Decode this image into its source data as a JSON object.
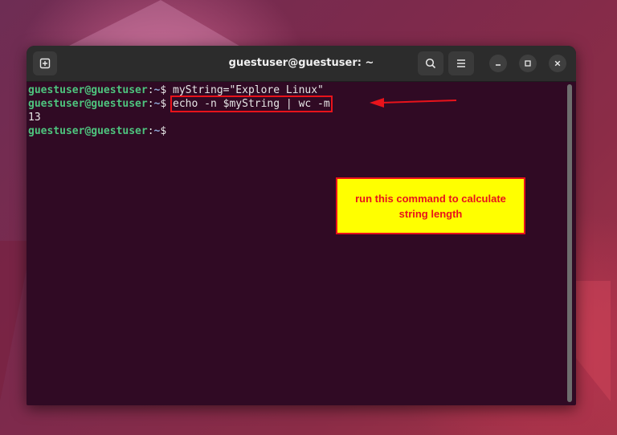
{
  "window": {
    "title": "guestuser@guestuser: ~"
  },
  "terminal": {
    "lines": [
      {
        "user": "guestuser@guestuser",
        "sep": ":",
        "path": "~",
        "sym": "$ ",
        "command": "myString=\"Explore Linux\""
      },
      {
        "user": "guestuser@guestuser",
        "sep": ":",
        "path": "~",
        "sym": "$ ",
        "command": "echo -n $myString | wc -m"
      },
      {
        "output": "13"
      },
      {
        "user": "guestuser@guestuser",
        "sep": ":",
        "path": "~",
        "sym": "$",
        "command": ""
      }
    ]
  },
  "annotation": {
    "text": "run this command to calculate string length",
    "border_color": "#e8131b",
    "background": "#ffff00"
  },
  "icons": {
    "new_tab": "new-tab-icon",
    "search": "search-icon",
    "menu": "hamburger-menu-icon",
    "minimize": "minimize-icon",
    "maximize": "maximize-icon",
    "close": "close-icon"
  }
}
